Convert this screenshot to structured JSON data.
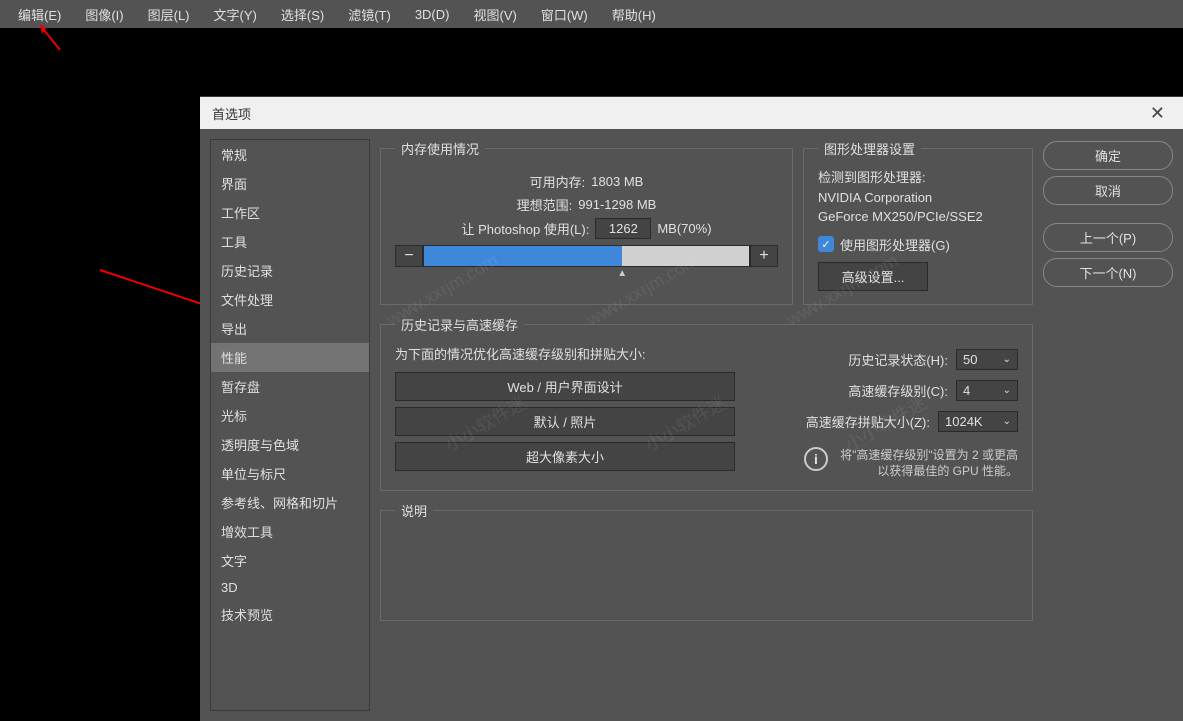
{
  "menubar": {
    "items": [
      "编辑(E)",
      "图像(I)",
      "图层(L)",
      "文字(Y)",
      "选择(S)",
      "滤镜(T)",
      "3D(D)",
      "视图(V)",
      "窗口(W)",
      "帮助(H)"
    ]
  },
  "dialog": {
    "title": "首选项",
    "sidebar": {
      "items": [
        "常规",
        "界面",
        "工作区",
        "工具",
        "历史记录",
        "文件处理",
        "导出",
        "性能",
        "暂存盘",
        "光标",
        "透明度与色域",
        "单位与标尺",
        "参考线、网格和切片",
        "增效工具",
        "文字",
        "3D",
        "技术预览"
      ],
      "selected_index": 7
    },
    "buttons": {
      "ok": "确定",
      "cancel": "取消",
      "prev": "上一个(P)",
      "next": "下一个(N)"
    },
    "memory": {
      "legend": "内存使用情况",
      "available_label": "可用内存:",
      "available_value": "1803 MB",
      "ideal_label": "理想范围:",
      "ideal_value": "991-1298 MB",
      "let_ps_use": "让 Photoshop 使用(L):",
      "use_value": "1262",
      "use_suffix": "MB(70%)",
      "minus": "−",
      "plus": "+"
    },
    "gpu": {
      "legend": "图形处理器设置",
      "detected_label": "检测到图形处理器:",
      "vendor": "NVIDIA Corporation",
      "model": "GeForce MX250/PCIe/SSE2",
      "use_gpu": "使用图形处理器(G)",
      "advanced": "高级设置..."
    },
    "cache": {
      "legend": "历史记录与高速缓存",
      "optimize_label": "为下面的情况优化高速缓存级别和拼贴大小:",
      "btn_web": "Web / 用户界面设计",
      "btn_default": "默认 / 照片",
      "btn_huge": "超大像素大小",
      "history_states_label": "历史记录状态(H):",
      "history_states_value": "50",
      "cache_levels_label": "高速缓存级别(C):",
      "cache_levels_value": "4",
      "cache_tile_label": "高速缓存拼贴大小(Z):",
      "cache_tile_value": "1024K",
      "tip": "将\"高速缓存级别\"设置为 2 或更高以获得最佳的 GPU 性能。",
      "info_char": "i"
    },
    "description": {
      "legend": "说明"
    }
  },
  "watermarks": [
    "www.xxrjm.com",
    "www.xxrjm.com",
    "www.xxrjm.com",
    "小小软件迷",
    "小小软件迷",
    "小小软件迷"
  ]
}
